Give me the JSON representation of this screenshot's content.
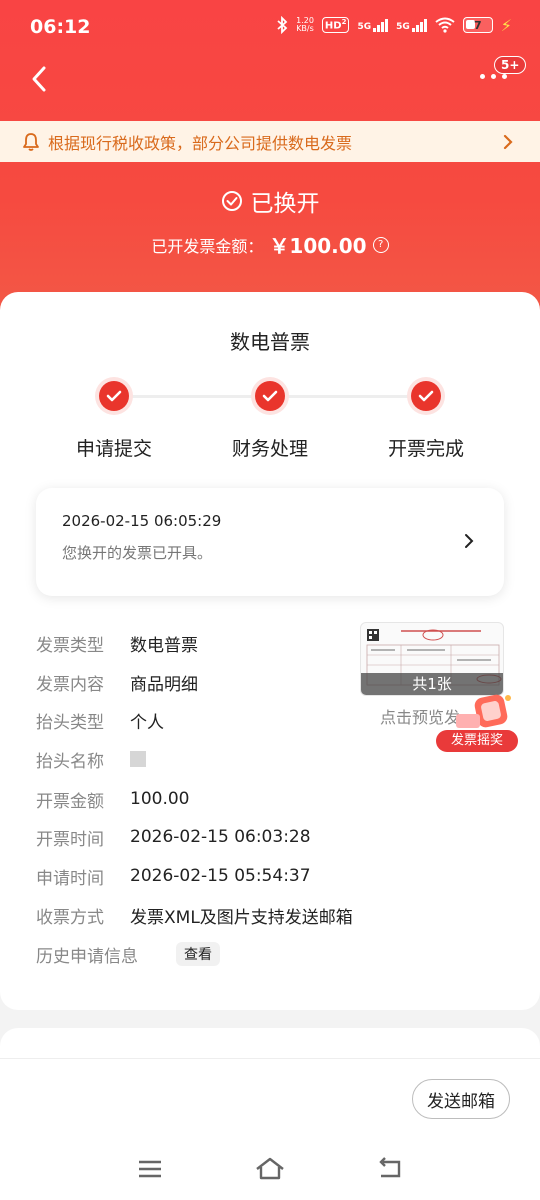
{
  "status_bar": {
    "time": "06:12",
    "net_speed_value": "1.20",
    "net_speed_unit": "KB/s",
    "hd_label": "HD",
    "hd_sub": "2",
    "signal1": "5G",
    "signal2": "5G",
    "battery": "7"
  },
  "header": {
    "more_badge": "5+"
  },
  "notice": {
    "text": "根据现行税收政策，部分公司提供数电发票"
  },
  "summary": {
    "status": "已换开",
    "amount_label": "已开发票金额：",
    "amount_value": "￥100.00",
    "help_symbol": "?"
  },
  "invoice": {
    "title": "数电普票",
    "steps": [
      {
        "label": "申请提交",
        "done": true
      },
      {
        "label": "财务处理",
        "done": true
      },
      {
        "label": "开票完成",
        "done": true
      }
    ],
    "progress": {
      "time": "2026-02-15 06:05:29",
      "message": "您换开的发票已开具。"
    },
    "details": [
      {
        "label": "发票类型",
        "value": "数电普票"
      },
      {
        "label": "发票内容",
        "value": "商品明细"
      },
      {
        "label": "抬头类型",
        "value": "个人"
      },
      {
        "label": "抬头名称",
        "value": ""
      },
      {
        "label": "开票金额",
        "value": "100.00"
      },
      {
        "label": "开票时间",
        "value": "2026-02-15 06:03:28"
      },
      {
        "label": "申请时间",
        "value": "2026-02-15 05:54:37"
      },
      {
        "label": "收票方式",
        "value": "发票XML及图片支持发送邮箱"
      },
      {
        "label": "历史申请信息",
        "value": "查看"
      }
    ],
    "thumbnail_caption": "共1张",
    "preview_hint": "点击预览发",
    "lottery_label": "发票摇奖"
  },
  "footer": {
    "send_mail": "发送邮箱"
  },
  "colors": {
    "brand_red": "#f64a40",
    "step_red": "#e9352c",
    "notice_bg": "#fff3e6",
    "notice_text": "#d96a1c"
  }
}
